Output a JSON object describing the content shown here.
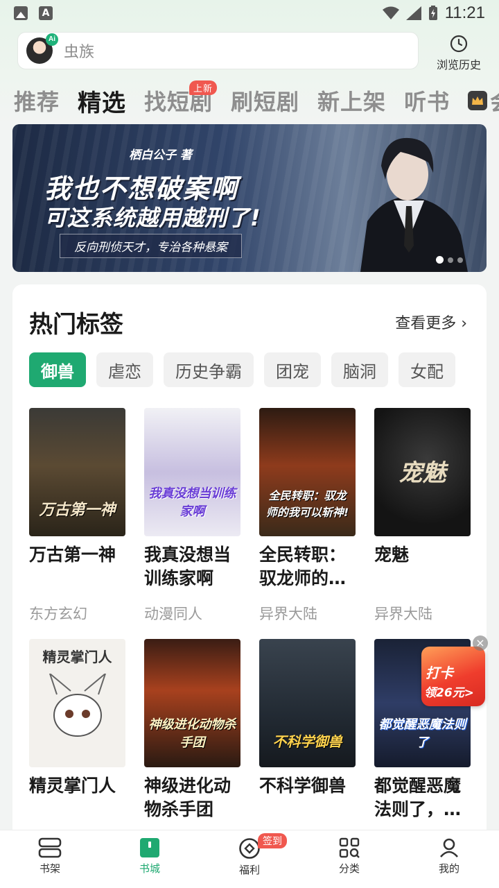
{
  "status_bar": {
    "time": "11:21"
  },
  "search": {
    "placeholder": "虫族",
    "ai_badge": "Ai",
    "history_label": "浏览历史"
  },
  "tabs": [
    {
      "label": "推荐",
      "active": false
    },
    {
      "label": "精选",
      "active": true
    },
    {
      "label": "找短剧",
      "badge": "上新"
    },
    {
      "label": "刷短剧"
    },
    {
      "label": "新上架"
    },
    {
      "label": "听书"
    },
    {
      "label": "会"
    }
  ],
  "banner": {
    "author": "栖白公子 著",
    "title_line1": "我也不想破案啊",
    "title_line2": "可这系统越用越刑了!",
    "subtitle": "反向刑侦天才，专治各种悬案",
    "page_count": 3,
    "active_index": 0
  },
  "hot_tags": {
    "title": "热门标签",
    "more": "查看更多",
    "tags": [
      "御兽",
      "虐恋",
      "历史争霸",
      "团宠",
      "脑洞",
      "女配"
    ],
    "active_tag": "御兽"
  },
  "books": [
    {
      "title": "万古第一神",
      "genre": "东方玄幻",
      "cover_text": "万古第一神"
    },
    {
      "title": "我真没想当训练家啊",
      "genre": "动漫同人",
      "cover_text": "我真没想当训练家啊"
    },
    {
      "title": "全民转职：驭龙师的…",
      "genre": "异界大陆",
      "cover_text": "全民转职：驭龙师的我可以斩神!"
    },
    {
      "title": "宠魅",
      "genre": "异界大陆",
      "cover_text": "宠魅"
    },
    {
      "title": "精灵掌门人",
      "genre": "",
      "cover_text": "精灵掌门人"
    },
    {
      "title": "神级进化动物杀手团",
      "genre": "",
      "cover_text": "神级进化动物杀手团"
    },
    {
      "title": "不科学御兽",
      "genre": "",
      "cover_text": "不科学御兽"
    },
    {
      "title": "都觉醒恶魔法则了，…",
      "genre": "",
      "cover_text": "都觉醒恶魔法则了"
    }
  ],
  "promo": {
    "line1": "打卡",
    "line2": "领26元>"
  },
  "bottom_nav": [
    {
      "label": "书架",
      "icon": "bookshelf-icon"
    },
    {
      "label": "书城",
      "icon": "bookstore-icon",
      "active": true
    },
    {
      "label": "福利",
      "icon": "welfare-icon",
      "badge": "签到"
    },
    {
      "label": "分类",
      "icon": "category-icon"
    },
    {
      "label": "我的",
      "icon": "profile-icon"
    }
  ],
  "colors": {
    "accent": "#1fa971",
    "badge": "#f0584f"
  }
}
